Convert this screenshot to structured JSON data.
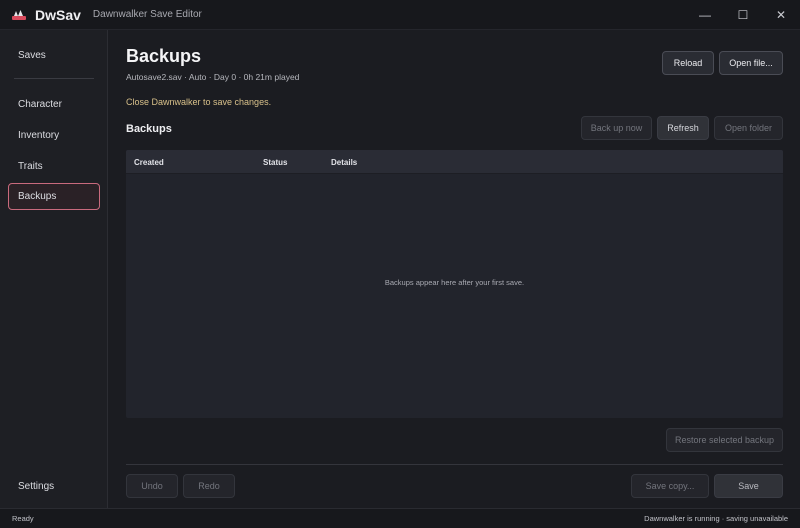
{
  "titlebar": {
    "app_name": "DwSav",
    "subtitle": "Dawnwalker Save Editor",
    "minimize_glyph": "—",
    "maximize_glyph": "☐",
    "close_glyph": "✕"
  },
  "sidebar": {
    "items": [
      {
        "label": "Saves"
      },
      {
        "label": "Character"
      },
      {
        "label": "Inventory"
      },
      {
        "label": "Traits"
      },
      {
        "label": "Backups",
        "active": true
      },
      {
        "label": "Settings"
      }
    ]
  },
  "main": {
    "title": "Backups",
    "meta": "Autosave2.sav · Auto · Day 0 · 0h 21m played",
    "warning": "Close Dawnwalker to save changes.",
    "section_title": "Backups",
    "buttons": {
      "reload": "Reload",
      "open_file": "Open file...",
      "back_up_now": "Back up now",
      "refresh": "Refresh",
      "open_folder": "Open folder",
      "restore": "Restore selected backup",
      "undo": "Undo",
      "redo": "Redo",
      "save_copy": "Save copy...",
      "save": "Save"
    },
    "table": {
      "columns": [
        "Created",
        "Status",
        "Details"
      ],
      "rows": [],
      "empty_message": "Backups appear here after your first save."
    }
  },
  "statusbar": {
    "left": "Ready",
    "right": "Dawnwalker is running · saving unavailable"
  },
  "colors": {
    "accent": "#c96a7d",
    "warning": "#d8c08a",
    "logo": "#d94b5e"
  }
}
